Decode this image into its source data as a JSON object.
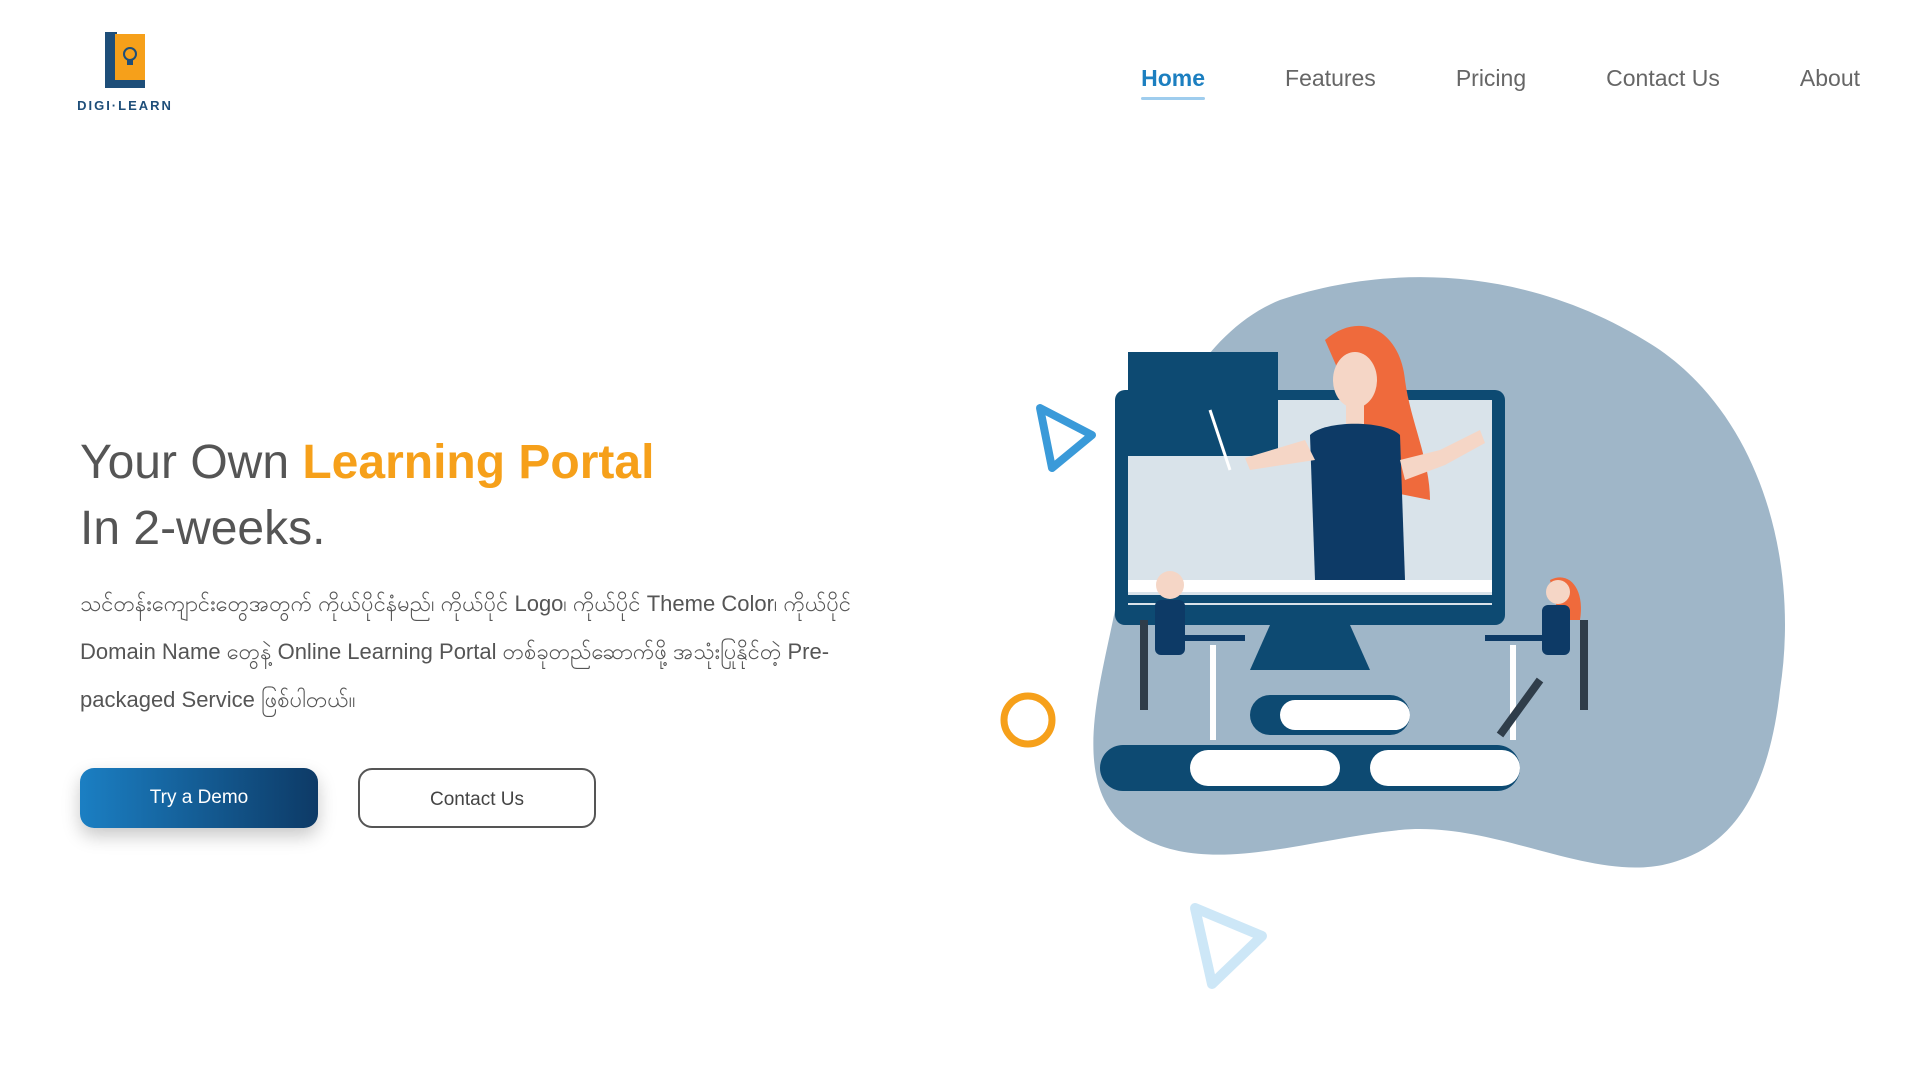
{
  "brand": {
    "name": "DIGI·LEARN",
    "tagline": "",
    "colors": {
      "accent": "#f6a01a",
      "primary": "#1c7fc0",
      "dark": "#0d3a66",
      "blob": "#9fb6c8"
    }
  },
  "nav": {
    "items": [
      {
        "label": "Home",
        "active": true
      },
      {
        "label": "Features",
        "active": false
      },
      {
        "label": "Pricing",
        "active": false
      },
      {
        "label": "Contact Us",
        "active": false
      },
      {
        "label": "About",
        "active": false
      }
    ]
  },
  "hero": {
    "title_prefix": "Your Own ",
    "title_accent": "Learning Portal",
    "title_line2": "In 2-weeks.",
    "description": "သင်တန်းကျောင်းတွေအတွက် ကိုယ်ပိုင်နံမည်၊ ကိုယ်ပိုင် Logo၊ ကိုယ်ပိုင် Theme Color၊ ကိုယ်ပိုင် Domain Name တွေနဲ့ Online Learning Portal တစ်ခုတည်ဆောက်ဖို့ အသုံးပြုနိုင်တဲ့ Pre-packaged Service ဖြစ်ပါတယ်။",
    "primary_button": "Try a Demo",
    "secondary_button": "Contact Us"
  },
  "illustration": {
    "icons": [
      "play-triangle-icon",
      "ring-icon",
      "play-triangle-icon"
    ]
  }
}
